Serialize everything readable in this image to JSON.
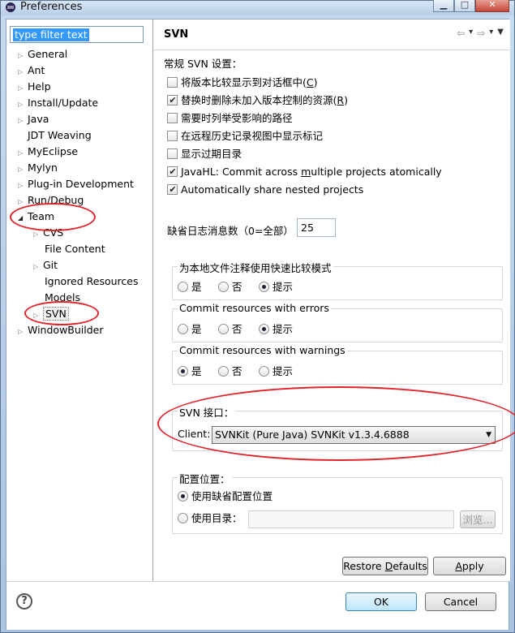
{
  "window": {
    "title": "Preferences"
  },
  "filter": {
    "placeholder": "type filter text"
  },
  "tree": {
    "items": [
      {
        "label": "General"
      },
      {
        "label": "Ant"
      },
      {
        "label": "Help"
      },
      {
        "label": "Install/Update"
      },
      {
        "label": "Java"
      },
      {
        "label": "JDT Weaving"
      },
      {
        "label": "MyEclipse"
      },
      {
        "label": "Mylyn"
      },
      {
        "label": "Plug-in Development"
      },
      {
        "label": "Run/Debug"
      },
      {
        "label": "Team"
      },
      {
        "label": "CVS"
      },
      {
        "label": "File Content"
      },
      {
        "label": "Git"
      },
      {
        "label": "Ignored Resources"
      },
      {
        "label": "Models"
      },
      {
        "label": "SVN"
      },
      {
        "label": "WindowBuilder"
      }
    ]
  },
  "page": {
    "title": "SVN",
    "general_label": "常规 SVN 设置：",
    "checks": [
      {
        "pre": "将版本比较显示到对话框中(",
        "u": "C",
        "post": ")",
        "checked": false
      },
      {
        "pre": "替换时删除未加入版本控制的资源(",
        "u": "R",
        "post": ")",
        "checked": true
      },
      {
        "pre": "需要时列举受影响的路径",
        "u": "",
        "post": "",
        "checked": false
      },
      {
        "pre": "在远程历史记录视图中显示标记",
        "u": "",
        "post": "",
        "checked": false
      },
      {
        "pre": "显示过期目录",
        "u": "",
        "post": "",
        "checked": false
      },
      {
        "pre": "JavaHL: Commit across ",
        "u": "m",
        "post": "ultiple projects atomically",
        "checked": true
      },
      {
        "pre": "Automatically share nested projects",
        "u": "",
        "post": "",
        "checked": true
      }
    ],
    "log_count_label": "缺省日志消息数（0=全部）",
    "log_count_value": "25",
    "group1": {
      "title": "为本地文件注释使用快速比较模式",
      "options": [
        "是",
        "否",
        "提示"
      ],
      "selected": 2
    },
    "group2": {
      "title": "Commit resources with errors",
      "options": [
        "是",
        "否",
        "提示"
      ],
      "selected": 2
    },
    "group3": {
      "title": "Commit resources with warnings",
      "options": [
        "是",
        "否",
        "提示"
      ],
      "selected": 0
    },
    "svn_iface": {
      "title": "SVN 接口：",
      "client_label": "Client:",
      "client_value": "SVNKit (Pure Java) SVNKit v1.3.4.6888"
    },
    "config": {
      "title": "配置位置：",
      "opt_default": "使用缺省配置位置",
      "opt_dir": "使用目录：",
      "browse": "浏览..."
    },
    "restore_pre": "Restore ",
    "restore_u": "D",
    "restore_post": "efaults",
    "apply_u": "A",
    "apply_post": "pply"
  },
  "dialog": {
    "ok": "OK",
    "cancel": "Cancel"
  },
  "colors": {
    "annotation": "#e0242a",
    "selection": "#3399ff"
  }
}
